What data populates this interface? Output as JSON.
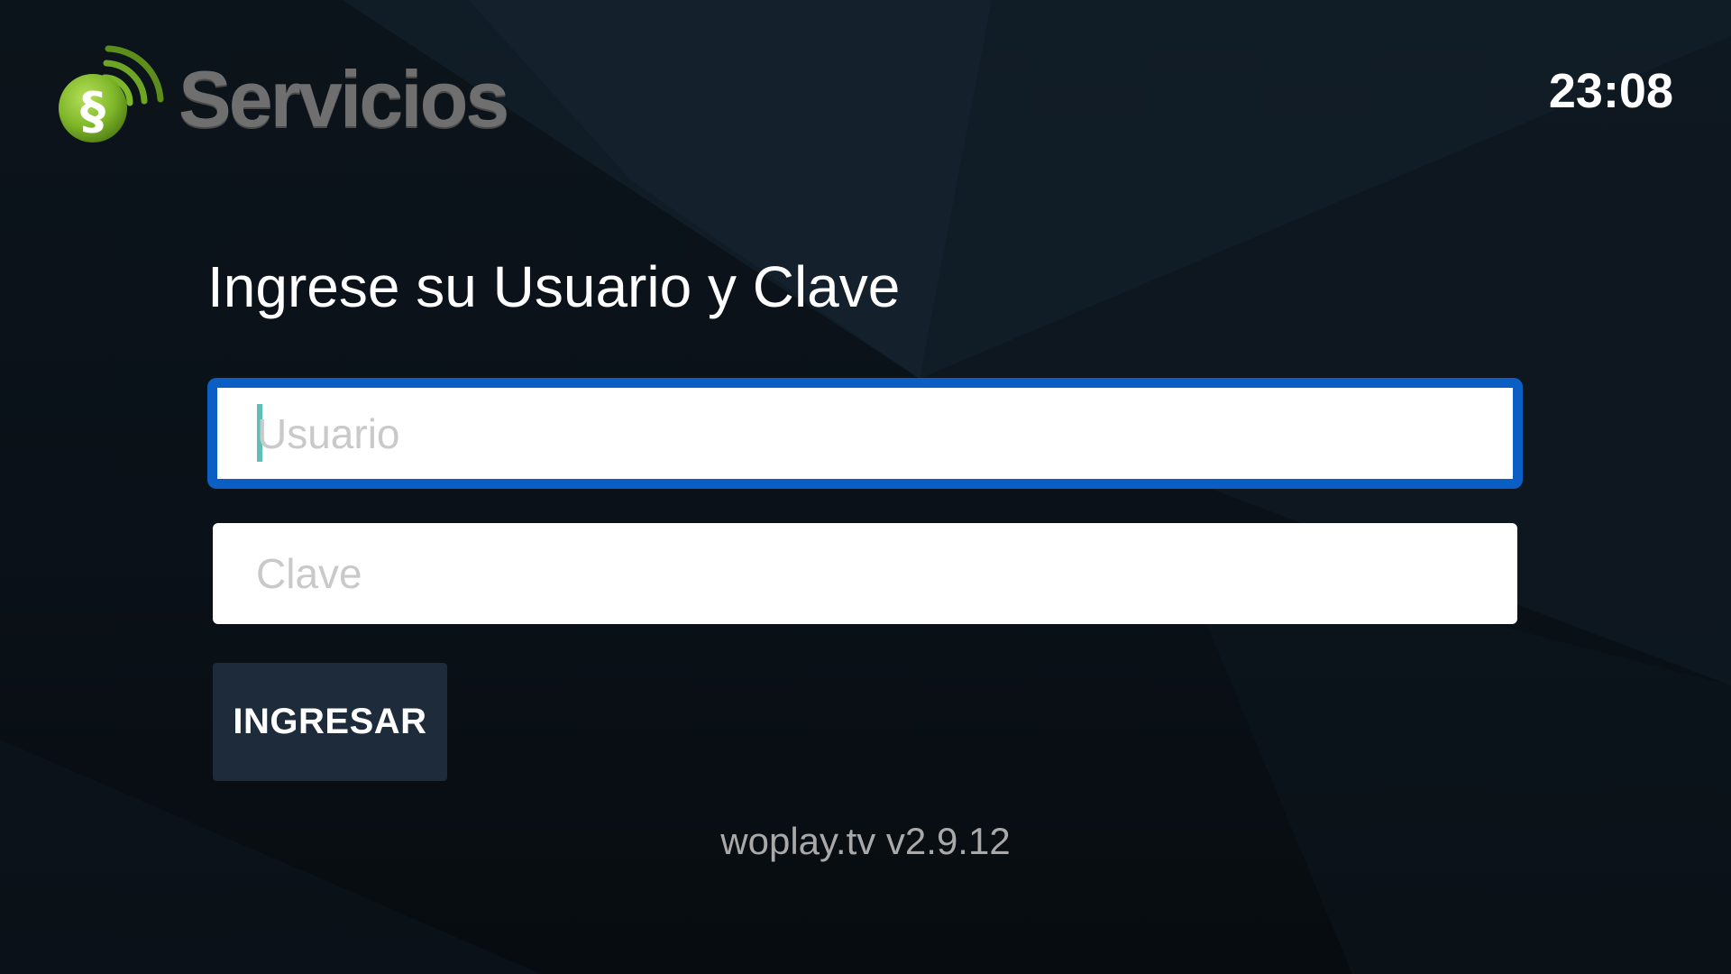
{
  "brand": {
    "name": "Servicios",
    "mark": "§",
    "green": "#7fb72a",
    "gray": "#6f6f6f"
  },
  "status": {
    "clock": "23:08"
  },
  "login": {
    "title": "Ingrese su Usuario y Clave",
    "username": {
      "placeholder": "Usuario",
      "value": "",
      "focused": true
    },
    "password": {
      "placeholder": "Clave",
      "value": ""
    },
    "submit_label": "INGRESAR"
  },
  "footer": {
    "version": "woplay.tv v2.9.12"
  },
  "colors": {
    "focus_border": "#0a5ec4",
    "button_bg": "#1d2b3b",
    "background": "#0a1016"
  }
}
